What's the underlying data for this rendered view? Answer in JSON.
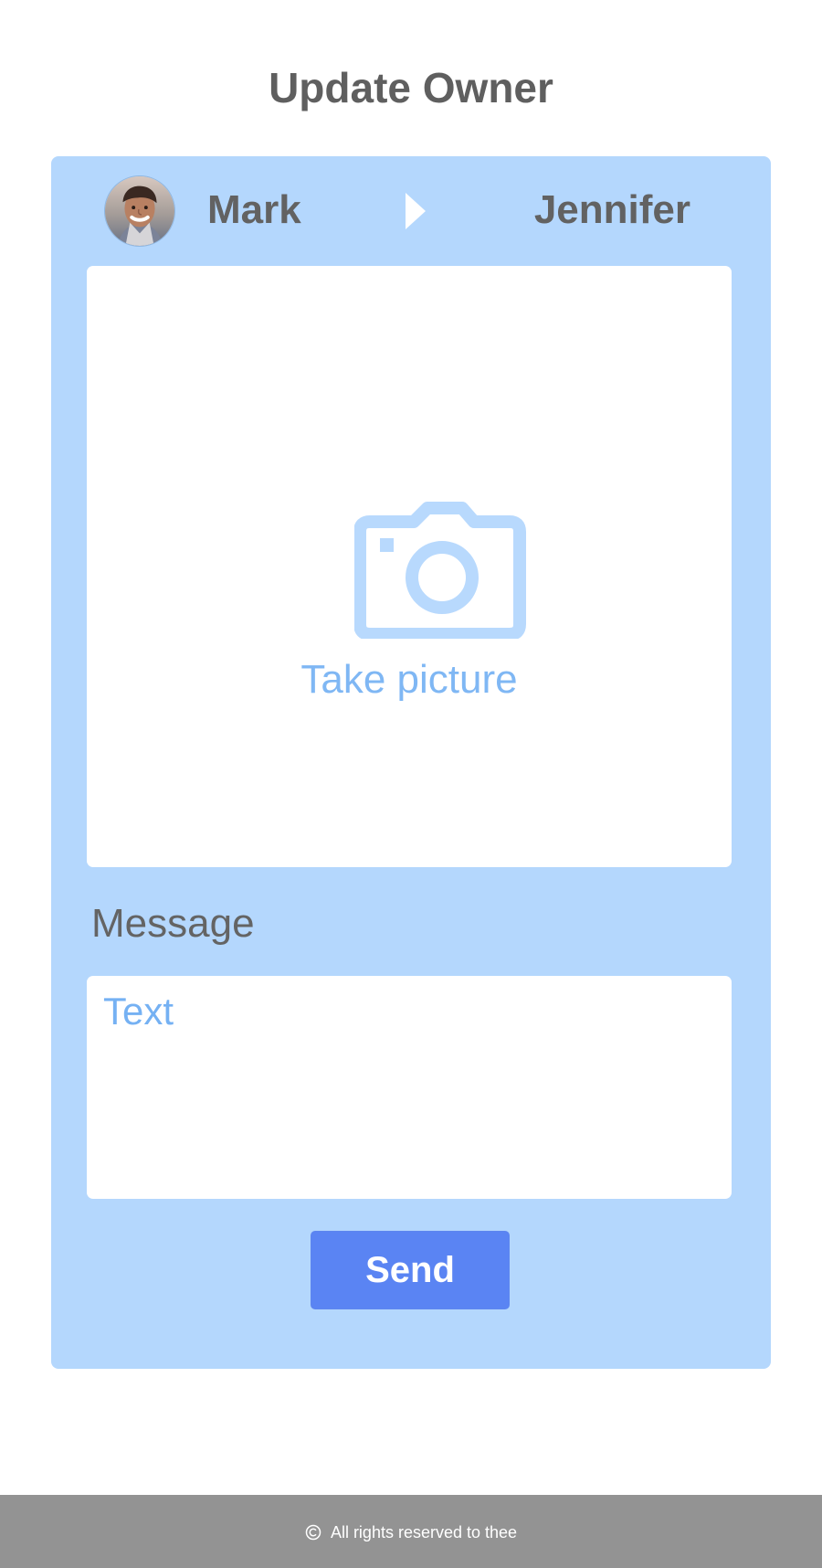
{
  "page": {
    "title": "Update Owner"
  },
  "owner_transfer": {
    "current_owner_name": "Mark",
    "new_owner_name": "Jennifer",
    "avatar": "profile-photo"
  },
  "photo": {
    "label": "Take picture",
    "icon": "camera-icon"
  },
  "message": {
    "label": "Message",
    "placeholder": "Text"
  },
  "actions": {
    "send_label": "Send"
  },
  "footer": {
    "copyright_icon": "copyright-icon",
    "text": "All rights reserved to thee"
  },
  "colors": {
    "card_background": "#b4d7fd",
    "button_background": "#5a84f3",
    "accent_text": "#7fb7f4",
    "footer_background": "#939393"
  }
}
